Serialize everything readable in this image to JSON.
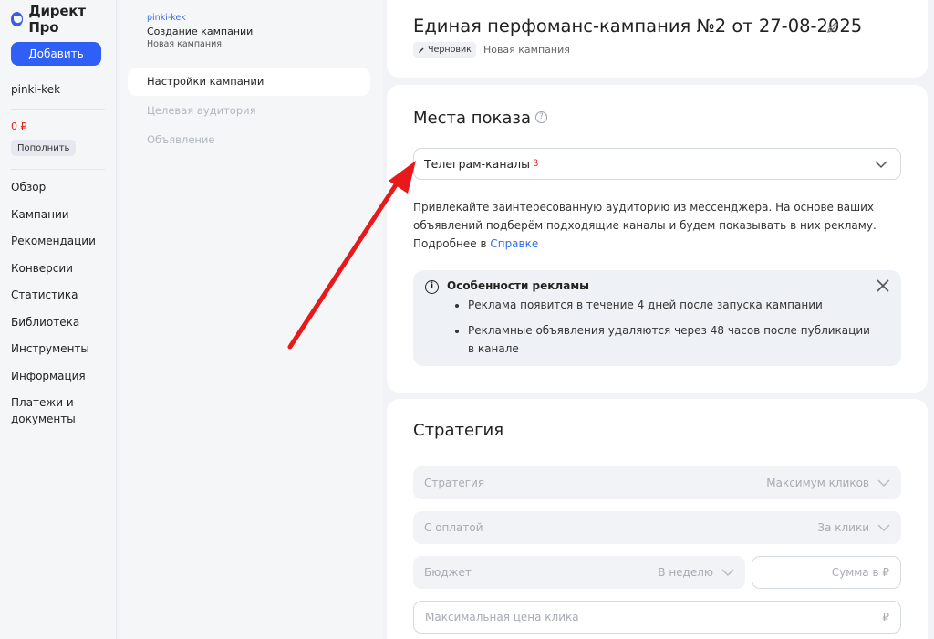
{
  "app": {
    "logo_text": "Директ Про",
    "add_button": "Добавить"
  },
  "account": {
    "user": "pinki-kek",
    "balance": "0 ₽",
    "topup_button": "Пополнить"
  },
  "nav": [
    "Обзор",
    "Кампании",
    "Рекомендации",
    "Конверсии",
    "Статистика",
    "Библиотека",
    "Инструменты",
    "Информация",
    "Платежи и документы"
  ],
  "subnav": {
    "user": "pinki-kek",
    "title": "Создание кампании",
    "subtitle": "Новая кампания",
    "items": [
      {
        "label": "Настройки кампании",
        "active": true
      },
      {
        "label": "Целевая аудитория",
        "active": false
      },
      {
        "label": "Объявление",
        "active": false
      }
    ]
  },
  "campaign": {
    "title": "Единая перфоманс-кампания №2 от 27-08-2025",
    "status_badge": "Черновик",
    "status_sub": "Новая кампания"
  },
  "placements": {
    "title": "Места показа",
    "select_value": "Телеграм-каналы",
    "beta_mark": "β",
    "description": "Привлекайте заинтересованную аудиторию из мессенджера. На основе ваших объявлений подберём подходящие каналы и будем показывать в них рекламу. Подробнее в ",
    "link": "Справке",
    "info": {
      "title": "Особенности рекламы",
      "items": [
        "Реклама появится в течение 4 дней после запуска кампании",
        "Рекламные объявления удаляются через 48 часов после публикации в канале"
      ]
    }
  },
  "strategy": {
    "title": "Стратегия",
    "fields": {
      "strategy": {
        "label": "Стратегия",
        "value": "Максимум кликов"
      },
      "payment": {
        "label": "С оплатой",
        "value": "За клики"
      },
      "budget": {
        "label": "Бюджет",
        "value": "В неделю"
      },
      "amount": {
        "placeholder": "Сумма в ₽"
      },
      "max_click": {
        "placeholder": "Максимальная цена клика",
        "suffix": "₽"
      }
    }
  },
  "colors": {
    "accent": "#2f5ff5",
    "arrow": "#e8191a",
    "balance": "#e0231a"
  }
}
